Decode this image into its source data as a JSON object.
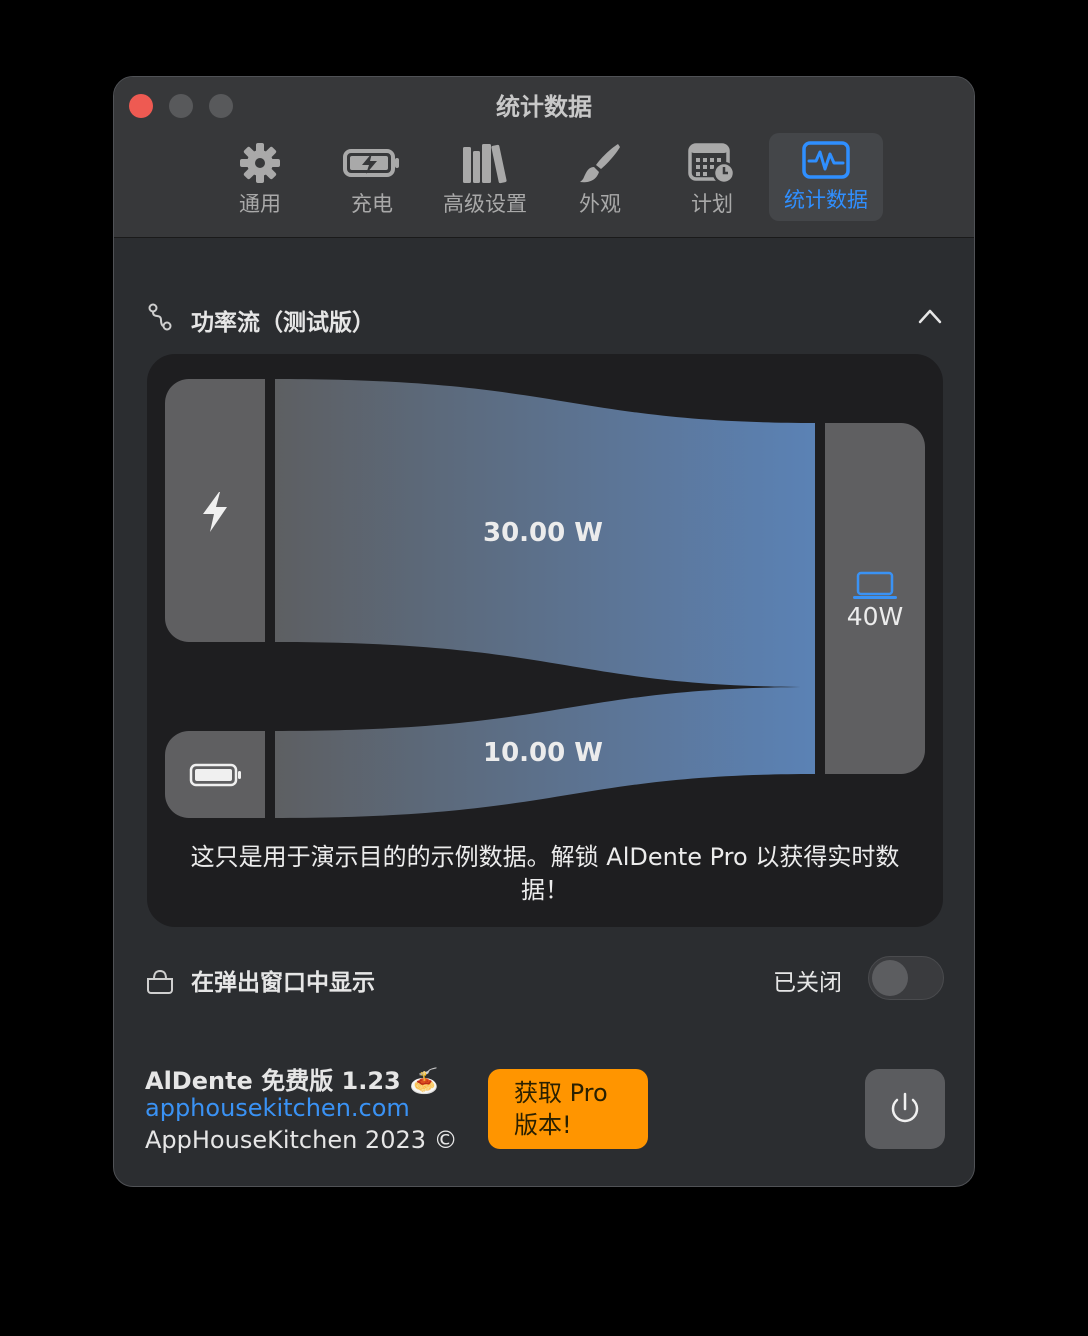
{
  "window": {
    "title": "统计数据"
  },
  "tabs": [
    {
      "label": "通用",
      "icon": "gear-icon"
    },
    {
      "label": "充电",
      "icon": "battery-charging-icon"
    },
    {
      "label": "高级设置",
      "icon": "books-icon"
    },
    {
      "label": "外观",
      "icon": "paintbrush-icon"
    },
    {
      "label": "计划",
      "icon": "calendar-clock-icon"
    },
    {
      "label": "统计数据",
      "icon": "waveform-icon",
      "active": true
    }
  ],
  "power_flow": {
    "title": "功率流（测试版）",
    "sources": [
      {
        "name": "charger",
        "icon": "lightning-icon",
        "value": "30.00 W"
      },
      {
        "name": "battery",
        "icon": "battery-icon",
        "value": "10.00 W"
      }
    ],
    "destination": {
      "icon": "laptop-icon",
      "value": "40W"
    },
    "note": "这只是用于演示目的的示例数据。解锁 AlDente Pro 以获得实时数据！"
  },
  "popup_setting": {
    "label": "在弹出窗口中显示",
    "status": "已关闭",
    "enabled": false
  },
  "footer": {
    "app_name": "AlDente 免费版 1.23 🍝",
    "link": "apphousekitchen.com",
    "copyright": "AppHouseKitchen 2023 ©",
    "pro_button": "获取 Pro 版本!"
  },
  "colors": {
    "accent": "#2f8fff",
    "pro": "#ff9500",
    "close": "#ee5a52"
  }
}
